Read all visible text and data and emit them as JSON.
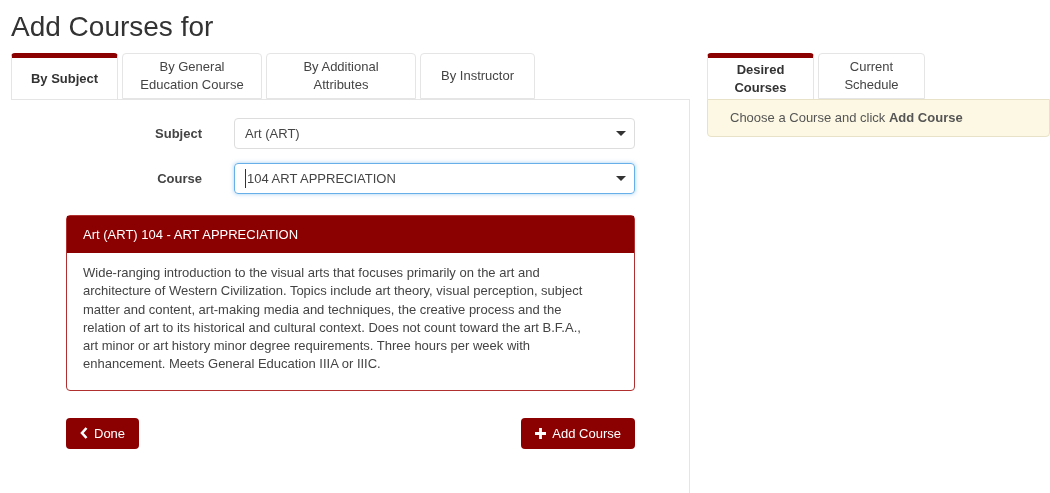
{
  "page_title": "Add Courses for",
  "search_tabs": [
    {
      "label": "By Subject",
      "selected": true
    },
    {
      "label": "By General Education Course",
      "selected": false
    },
    {
      "label": "By Additional Attributes",
      "selected": false
    },
    {
      "label": "By Instructor",
      "selected": false
    }
  ],
  "fields": [
    {
      "label": "Subject",
      "value": "Art (ART)",
      "focused": false
    },
    {
      "label": "Course",
      "value": "104 ART APPRECIATION",
      "focused": true
    }
  ],
  "course_card": {
    "title": "Art (ART) 104 - ART APPRECIATION",
    "description": "Wide-ranging introduction to the visual arts that focuses primarily on the art and architecture of Western Civilization. Topics include art theory, visual perception, subject matter and content, art-making media and techniques, the creative process and the relation of art to its historical and cultural context. Does not count toward the art B.F.A., art minor or art history minor degree requirements. Three hours per week with enhancement. Meets General Education IIIA or IIIC."
  },
  "buttons": [
    {
      "kind": "back",
      "label": "Done"
    },
    {
      "kind": "add",
      "label": "Add Course"
    }
  ],
  "side_tabs": [
    {
      "label": "Desired Courses",
      "selected": true
    },
    {
      "label": "Current Schedule",
      "selected": false
    }
  ],
  "side_notice": "Choose a Course and click **Add Course**"
}
